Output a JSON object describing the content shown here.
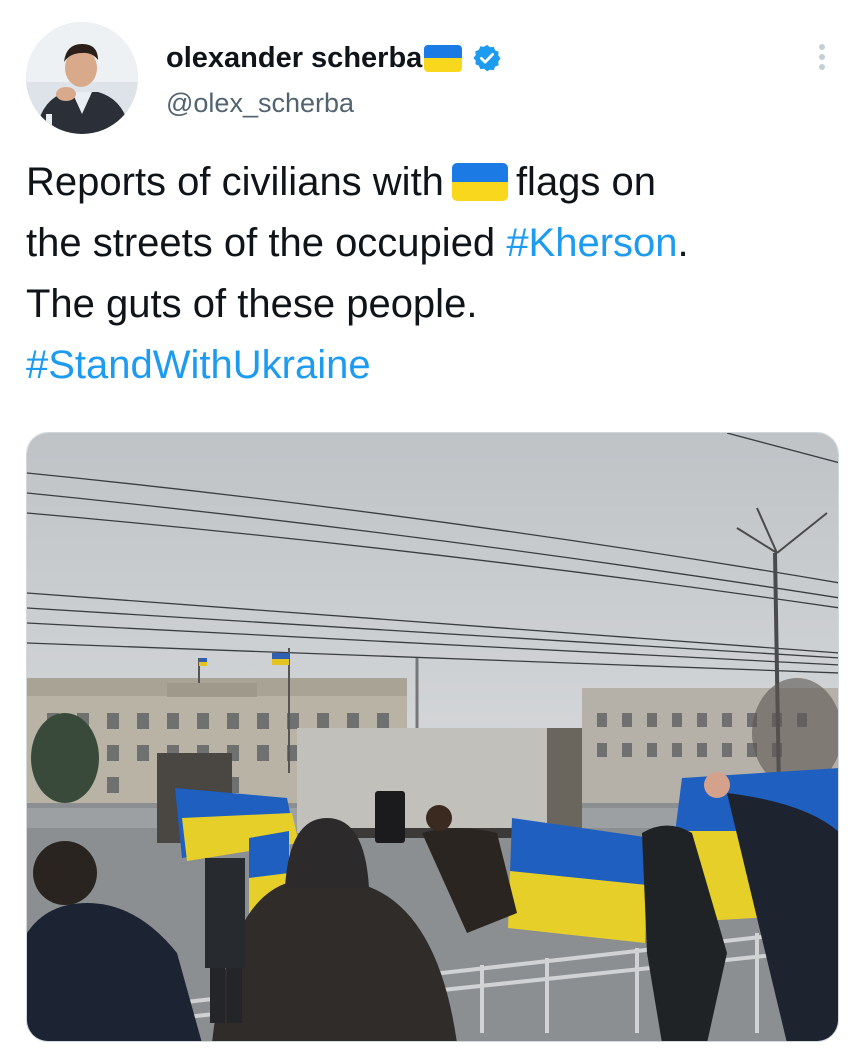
{
  "tweet": {
    "display_name": "olexander scherba",
    "handle": "@olex_scherba",
    "verified": true,
    "text": {
      "line1_before": "Reports of civilians with",
      "line1_after": "flags on",
      "line2_before": "the streets of the occupied",
      "hashtag1": "#Kherson",
      "line2_after": ".",
      "line3": "The guts of these people.",
      "hashtag2": "#StandWithUkraine"
    },
    "flag_emoji": "ukraine-flag-icon"
  },
  "colors": {
    "link": "#1d9bf0",
    "handle": "#536471",
    "flag_blue": "#1c7ae4",
    "flag_yellow": "#f9d71c",
    "verified": "#1d9bf0"
  }
}
